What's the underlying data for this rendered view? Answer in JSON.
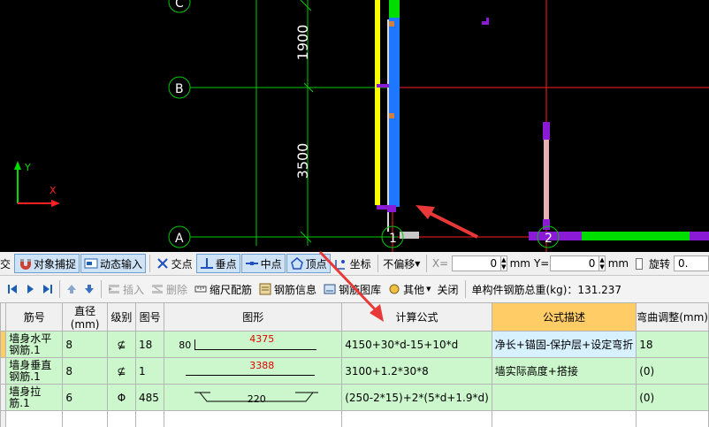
{
  "cad": {
    "axis_labels": {
      "c": "C",
      "b": "B",
      "a": "A",
      "n1": "1",
      "n2": "2"
    },
    "dimensions": {
      "upper": "1900",
      "lower": "3500"
    },
    "ucs": {
      "x": "X",
      "y": "Y"
    },
    "colors": {
      "wall_blue": "#1e78ff",
      "wall_yellow": "#ffff00",
      "green": "#00dd00",
      "purple": "#8a1ad6",
      "red": "#ff2020",
      "grid_green": "#00c800"
    }
  },
  "snap_toolbar": {
    "ortho": "正交",
    "object_snap": "对象捕捉",
    "dynamic_input": "动态输入",
    "intersection": "交点",
    "perpendicular": "垂点",
    "midpoint": "中点",
    "vertex": "顶点",
    "coordinate": "坐标",
    "offset_mode": "不偏移",
    "x_label": "X=",
    "x_value": "0",
    "unit_mm": "mm",
    "y_label": "Y=",
    "y_value": "0",
    "rotate": "旋转",
    "rotate_value": "0."
  },
  "table_toolbar": {
    "insert": "插入",
    "delete": "删除",
    "scale_rebar": "缩尺配筋",
    "rebar_info": "钢筋信息",
    "rebar_library": "钢筋图库",
    "other": "其他",
    "close": "关闭",
    "total_weight": "单构件钢筋总重(kg)：131.237"
  },
  "grid": {
    "headers": {
      "bar_no": "筋号",
      "diameter": "直径(mm)",
      "grade": "级别",
      "figure_no": "图号",
      "shape": "图形",
      "formula": "计算公式",
      "formula_desc": "公式描述",
      "bend_adjust": "弯曲调整(mm)"
    },
    "rows": [
      {
        "name": "墙身水平钢筋.1",
        "diameter": "8",
        "grade": "⊈",
        "figure_no": "18",
        "shape_lead": "80",
        "shape_len": "4375",
        "formula": "4150+30*d-15+10*d",
        "desc": "净长+锚固-保护层+设定弯折",
        "bend": "18"
      },
      {
        "name": "墙身垂直钢筋.1",
        "diameter": "8",
        "grade": "⊈",
        "figure_no": "1",
        "shape_len": "3388",
        "formula": "3100+1.2*30*8",
        "desc": "墙实际高度+搭接",
        "bend": "(0)"
      },
      {
        "name": "墙身拉筋.1",
        "diameter": "6",
        "grade": "Φ",
        "figure_no": "485",
        "shape_len": "220",
        "formula": "(250-2*15)+2*(5*d+1.9*d)",
        "desc": "",
        "bend": "(0)"
      }
    ]
  }
}
